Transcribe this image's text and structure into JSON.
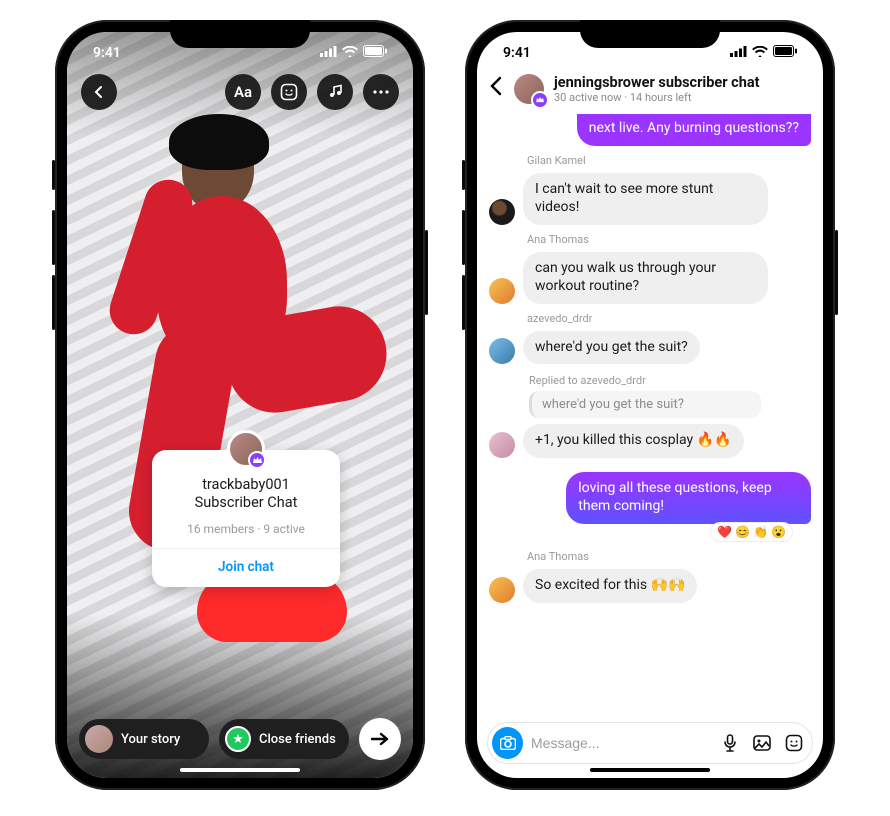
{
  "status": {
    "time": "9:41"
  },
  "story": {
    "tool_text_label": "Aa",
    "card": {
      "title_line1": "trackbaby001",
      "title_line2": "Subscriber Chat",
      "subtitle": "16 members · 9 active",
      "action": "Join chat"
    },
    "bottom": {
      "your_story": "Your story",
      "close_friends": "Close friends"
    }
  },
  "chat": {
    "header": {
      "title": "jenningsbrower subscriber chat",
      "subtitle": "30 active now · 14 hours left"
    },
    "messages": {
      "out_top": "next live. Any burning questions??",
      "s1": "Gilan Kamel",
      "m1": "I can't wait to see more stunt videos!",
      "s2": "Ana Thomas",
      "m2": "can you walk us through your workout routine?",
      "s3": "azevedo_drdr",
      "m3": "where'd you get the suit?",
      "reply_label": "Replied to azevedo_drdr",
      "quote": "where'd you get the suit?",
      "m4": "+1, you killed this cosplay 🔥🔥",
      "out_mid": "loving all these questions, keep them coming!",
      "reactions": "❤️ 😊 👏 😮",
      "s5": "Ana Thomas",
      "m5": "So excited for this 🙌🙌"
    },
    "composer": {
      "placeholder": "Message..."
    }
  }
}
